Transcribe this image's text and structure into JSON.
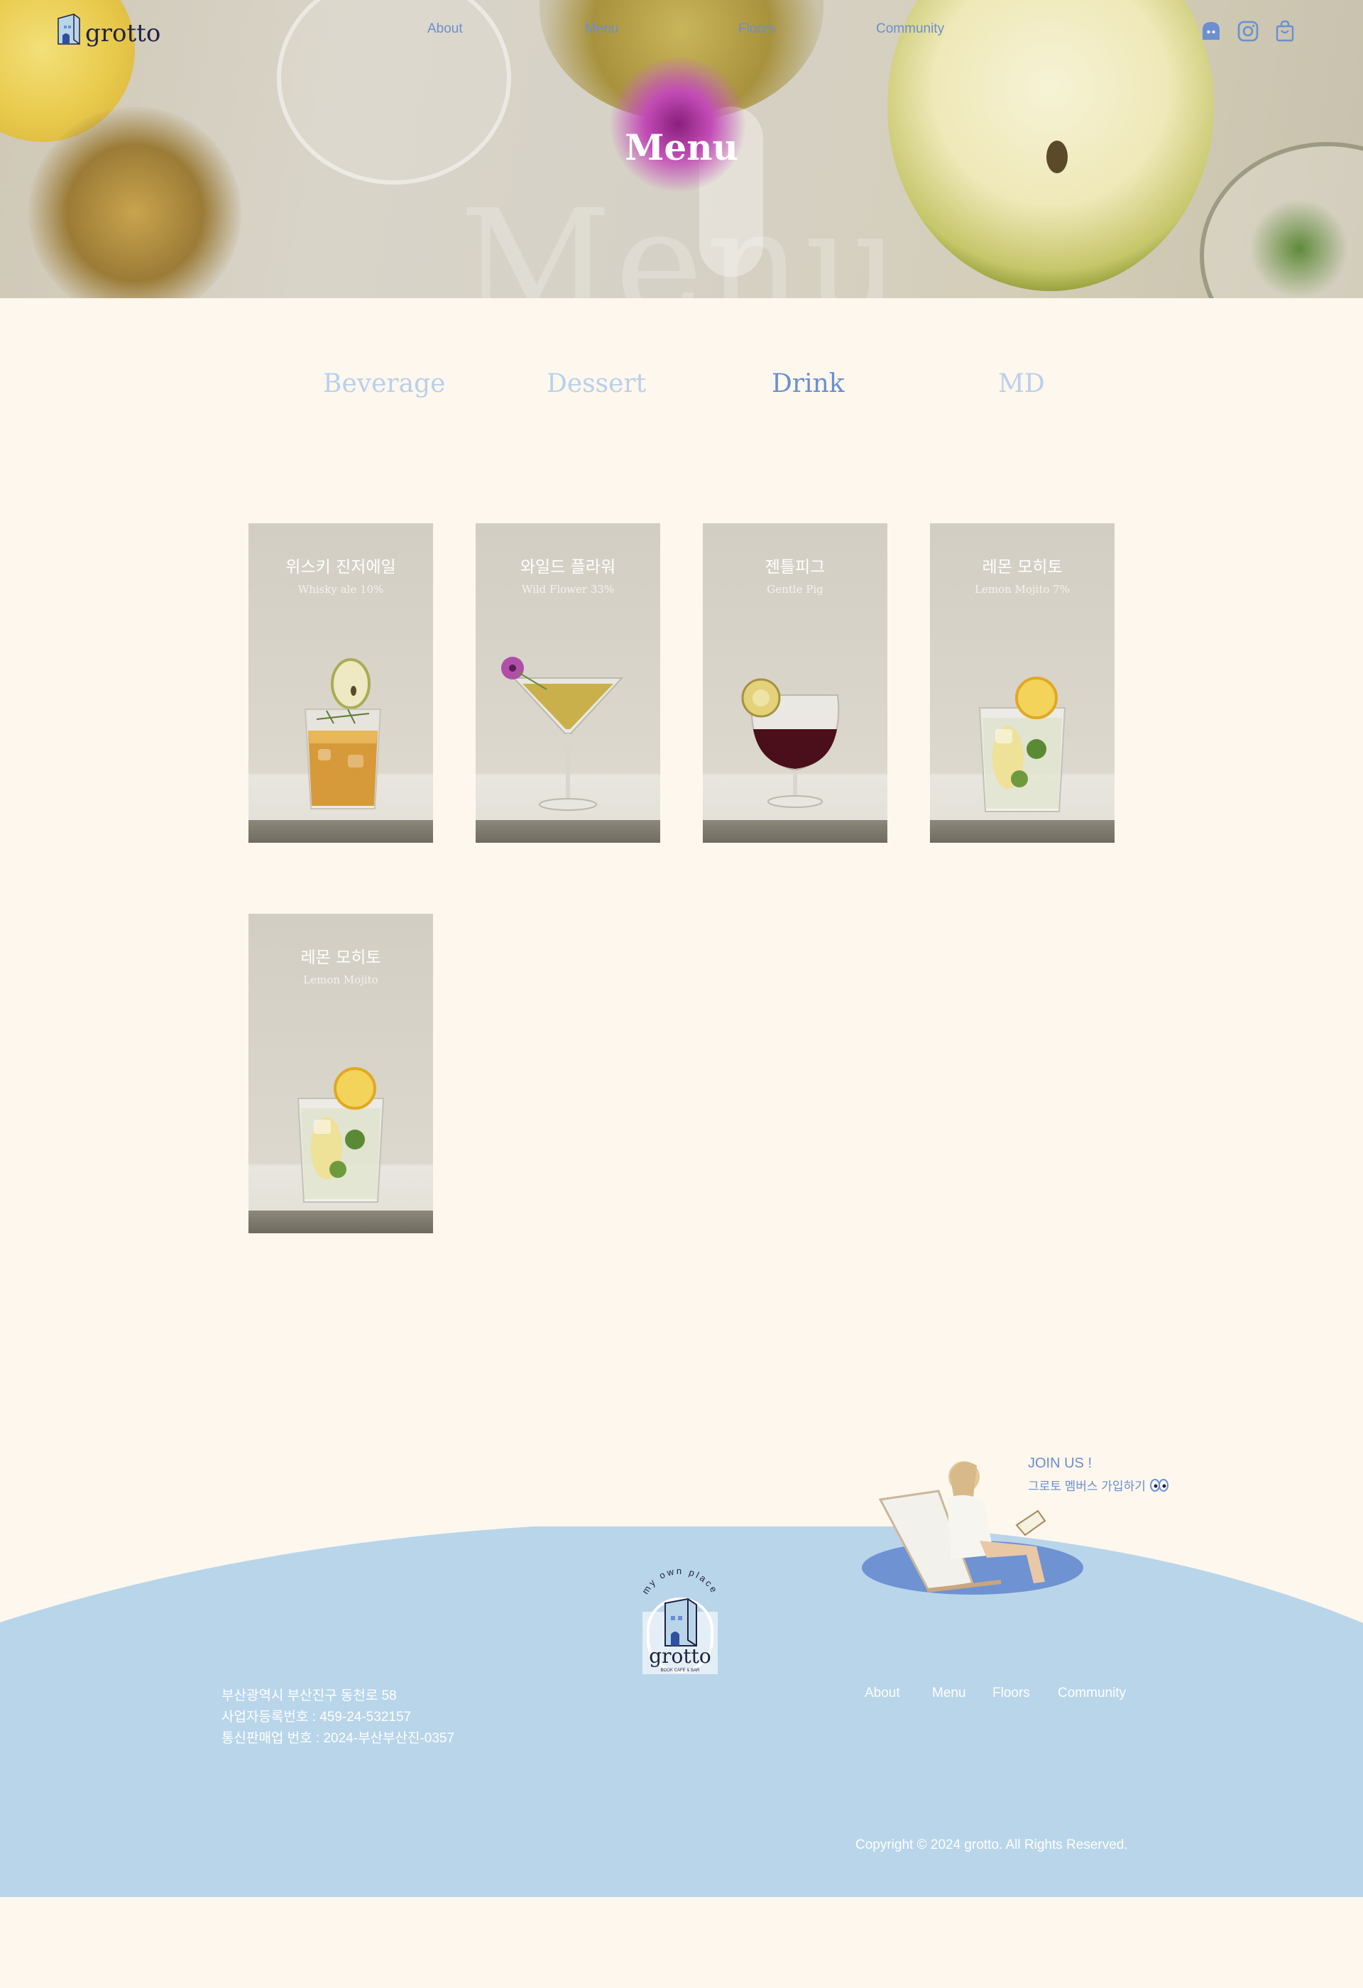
{
  "brand": {
    "name": "grotto",
    "tagline": "BOOK CAFE & BAR",
    "badge_text": "my own place"
  },
  "nav": {
    "about": "About",
    "menu": "Menu",
    "floors": "Floors",
    "community": "Community"
  },
  "nav_icons": [
    "ghost-icon",
    "instagram-icon",
    "shopping-bag-icon"
  ],
  "hero": {
    "title": "Menu",
    "background_word": "Menu"
  },
  "tabs": [
    {
      "label": "Beverage"
    },
    {
      "label": "Dessert"
    },
    {
      "label": "Drink",
      "active": true
    },
    {
      "label": "MD"
    }
  ],
  "items": [
    {
      "name_ko": "위스키 진저에일",
      "name_en": "Whisky ale 10%",
      "drink": "whisky-highball"
    },
    {
      "name_ko": "와일드 플라워",
      "name_en": "Wild Flower 33%",
      "drink": "martini"
    },
    {
      "name_ko": "젠틀피그",
      "name_en": "Gentle Pig",
      "drink": "red-wine"
    },
    {
      "name_ko": "레몬 모히토",
      "name_en": "Lemon Mojito 7%",
      "drink": "mojito"
    },
    {
      "name_ko": "레몬 모히토",
      "name_en": "Lemon Mojito",
      "drink": "mojito"
    }
  ],
  "join": {
    "title": "JOIN US !",
    "subtitle": "그로토 멤버스 가입하기"
  },
  "footer": {
    "address": "부산광역시 부산진구 동천로 58",
    "business_number": "사업자등록번호 : 459-24-532157",
    "mail_order_number": "통신판매업 번호 : 2024-부산부산진-0357",
    "copyright": "Copyright © 2024 grotto. All Rights Reserved.",
    "nav": {
      "about": "About",
      "menu": "Menu",
      "floors": "Floors",
      "community": "Community"
    }
  },
  "colors": {
    "accent": "#6b8fd0",
    "tab_inactive": "#b9d0ea",
    "footer_blue": "#b9d5ea",
    "page_bg": "#fdf7ee"
  }
}
